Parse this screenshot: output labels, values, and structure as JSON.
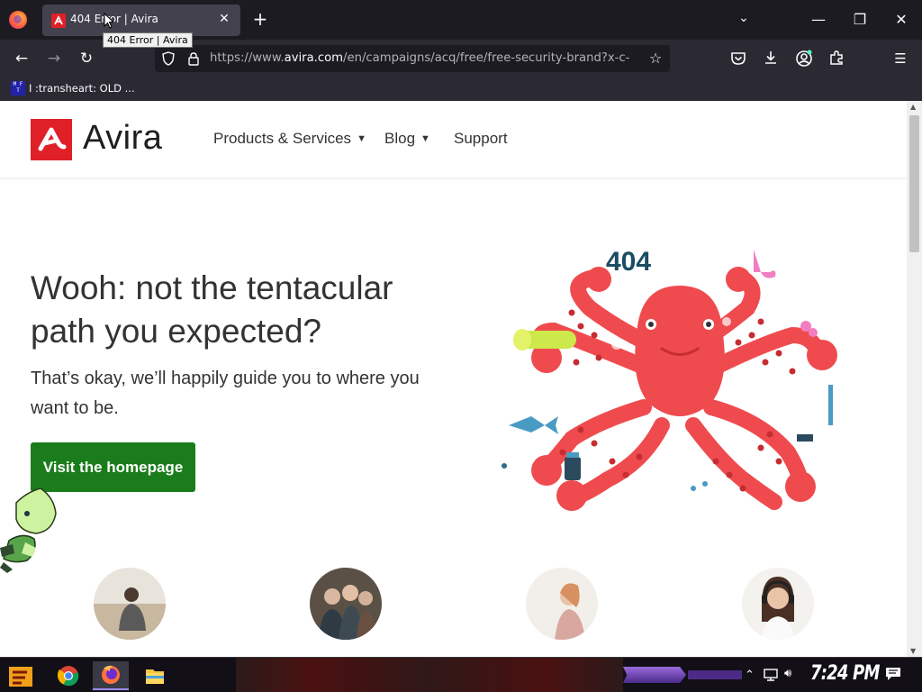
{
  "browser": {
    "tab_title": "404 Error | Avira",
    "tooltip": "404 Error | Avira",
    "url_prefix": "https://www.",
    "url_domain": "avira.com",
    "url_suffix": "/en/campaigns/acq/free/free-security-brand?x-c-",
    "bookmark_label": "I :transheart: OLD ..."
  },
  "site": {
    "logo_text": "Avira",
    "nav": [
      {
        "label": "Products & Services",
        "has_dropdown": true
      },
      {
        "label": "Blog",
        "has_dropdown": true
      },
      {
        "label": "Support",
        "has_dropdown": false
      }
    ],
    "headline": "Wooh: not the tentacular path you expected?",
    "subtext": "That’s okay, we’ll happily guide you to where you want to be.",
    "cta_label": "Visit the homepage",
    "illustration_code": "404",
    "brand_color": "#e02027",
    "cta_color": "#1a7c1a"
  },
  "taskbar": {
    "clock": "7:24 PM"
  }
}
